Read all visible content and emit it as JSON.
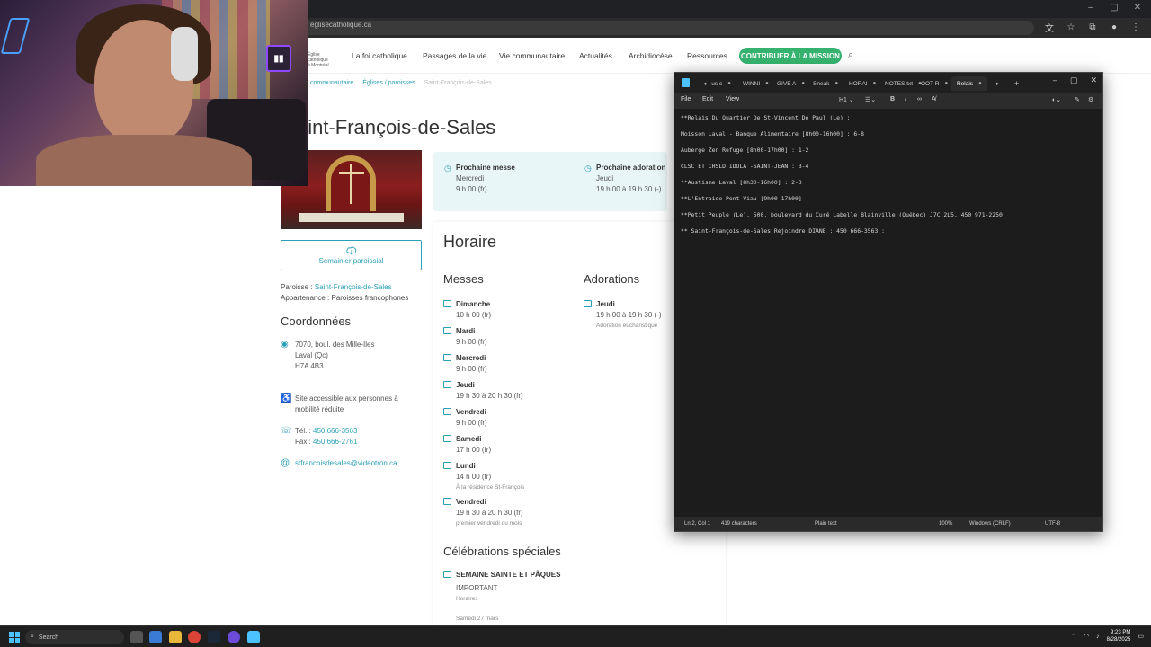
{
  "browser": {
    "url": "eglisecatholique.ca",
    "icons": [
      "translate-icon",
      "star-icon",
      "extensions-icon",
      "profile-icon"
    ],
    "window_controls": [
      "–",
      "▢",
      "✕"
    ]
  },
  "site": {
    "logo_lines": [
      "Église",
      "catholique",
      "à Montréal"
    ],
    "nav": [
      "La foi catholique",
      "Passages de la vie",
      "Vie communautaire",
      "Actualités",
      "Archidiocèse",
      "Ressources"
    ],
    "cta": "CONTRIBUER À LA MISSION",
    "breadcrumb": [
      "communautaire",
      "Églises / paroisses",
      "Saint-François-de-Sales"
    ],
    "title": "aint-François-de-Sales",
    "semainier": "Semainier paroissial",
    "paroisse_label": "Paroisse :",
    "paroisse_value": "Saint-François-de-Sales",
    "appartenance": "Appartenance : Paroisses francophones",
    "coordonnees_title": "Coordonnées",
    "address": [
      "7070, boul. des Mille-Iles",
      "Laval (Qc)",
      "H7A 4B3"
    ],
    "accessible": [
      "Site accessible aux personnes à",
      "mobilité réduite"
    ],
    "tel_label": "Tél. :",
    "tel": "450 666-3563",
    "fax_label": "Fax :",
    "fax": "450 666-2761",
    "email": "stfrancoisdesales@videotron.ca",
    "next_mass": {
      "title": "Prochaine messe",
      "day": "Mercredi",
      "time": "9 h 00 (fr)"
    },
    "next_adoration": {
      "title": "Prochaine adoration",
      "day": "Jeudi",
      "time": "19 h 00 à 19 h 30 (-)"
    },
    "horaire_title": "Horaire",
    "messes_title": "Messes",
    "messes": [
      {
        "day": "Dimanche",
        "time": "10 h 00 (fr)",
        "note": ""
      },
      {
        "day": "Mardi",
        "time": "9 h 00 (fr)",
        "note": ""
      },
      {
        "day": "Mercredi",
        "time": "9 h 00 (fr)",
        "note": ""
      },
      {
        "day": "Jeudi",
        "time": "19 h 30 à 20 h 30 (fr)",
        "note": ""
      },
      {
        "day": "Vendredi",
        "time": "9 h 00 (fr)",
        "note": ""
      },
      {
        "day": "Samedi",
        "time": "17 h 00 (fr)",
        "note": ""
      },
      {
        "day": "Lundi",
        "time": "14 h 00 (fr)",
        "note": "À la résidence St-François"
      },
      {
        "day": "Vendredi",
        "time": "19 h 30 à 20 h 30 (fr)",
        "note": "premier vendredi du mois"
      }
    ],
    "adorations_title": "Adorations",
    "adorations": [
      {
        "day": "Jeudi",
        "time": "19 h 00 à 19 h 30 (-)",
        "note": "Adoration eucharistique"
      }
    ],
    "celebrations_title": "Célébrations spéciales",
    "celebration": {
      "title": "SEMAINE SAINTE ET PÂQUES",
      "sub": "IMPORTANT",
      "note": "Horaires",
      "extra": "Samedi 27 mars"
    }
  },
  "notepad": {
    "tabs": [
      "us c",
      "WINNI",
      "GIVE A",
      "Sneak",
      "HORAI",
      "NOTES.txt",
      "OOT R",
      "Relais"
    ],
    "active_tab": "Relais",
    "menu": [
      "File",
      "Edit",
      "View"
    ],
    "heading": "H1",
    "lines": [
      "**Relais Du Quartier De St-Vincent De Paul (Le) :",
      "Moisson Laval - Banque Alimentaire [8h00-16h00] : 6-8",
      "Auberge Zen Refuge [8h00-17h00] : 1-2",
      "CLSC ET CHSLD IDOLA -SAINT-JEAN : 3-4",
      "**Austisme Laval [8h30-16h00] : 2-3",
      "**L'Entraide Pont-Viau [9h00-17h00] :",
      "**Petit Peuple (Le). 500, boulevard du Curé Labelle Blainville (Québec) J7C 2L5. 450 971-2250",
      "** Saint-François-de-Sales Rejoindre DIANE : 450 666-3563 :"
    ],
    "status": {
      "pos": "Ln 2, Col 1",
      "chars": "419 characters",
      "mode": "Plain text",
      "zoom": "100%",
      "eol": "Windows (CRLF)",
      "enc": "UTF-8"
    }
  },
  "webcam": {
    "twitch_label": "Twitch"
  },
  "taskbar": {
    "search": "Search",
    "time": "9:23 PM",
    "date": "8/28/2025"
  }
}
